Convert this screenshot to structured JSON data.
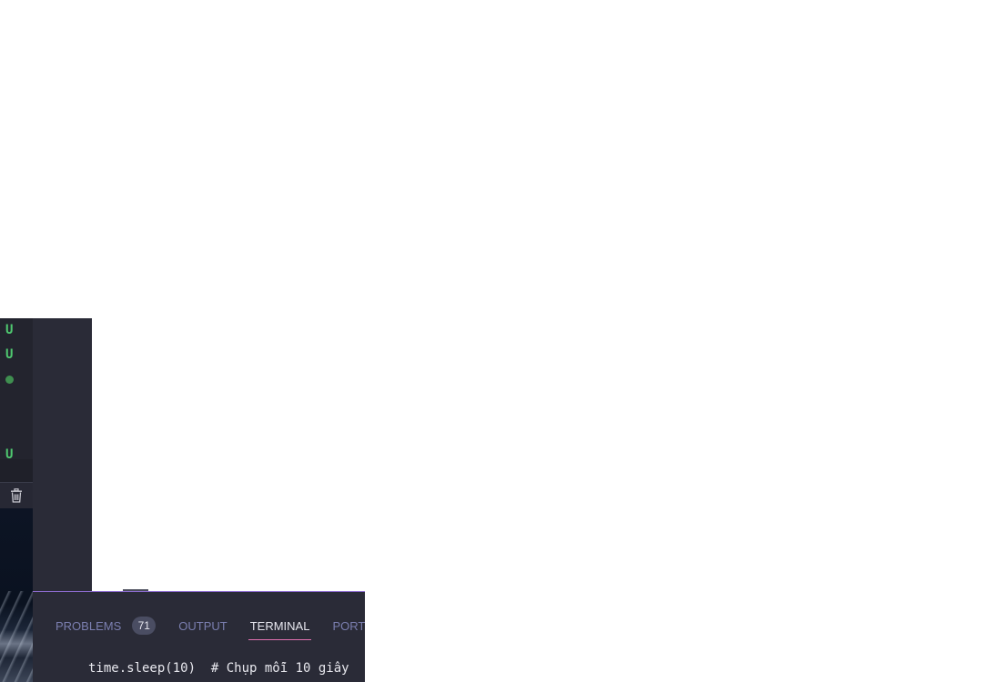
{
  "explorer": {
    "git_status": [
      "U",
      "U",
      "U"
    ]
  },
  "panel": {
    "tabs": [
      {
        "label": "PROBLEMS",
        "badge": "71"
      },
      {
        "label": "OUTPUT"
      },
      {
        "label": "TERMINAL"
      },
      {
        "label": "PORTS"
      }
    ],
    "active_tab": "TERMINAL",
    "terminal_line": "time.sleep(10)  # Chụp mỗi 10 giây"
  },
  "colors": {
    "git_untracked": "#4fc970",
    "active_tab_underline": "#e070b0",
    "panel_border": "#8c6ccf"
  },
  "icons": {
    "trash": "trash-icon"
  }
}
